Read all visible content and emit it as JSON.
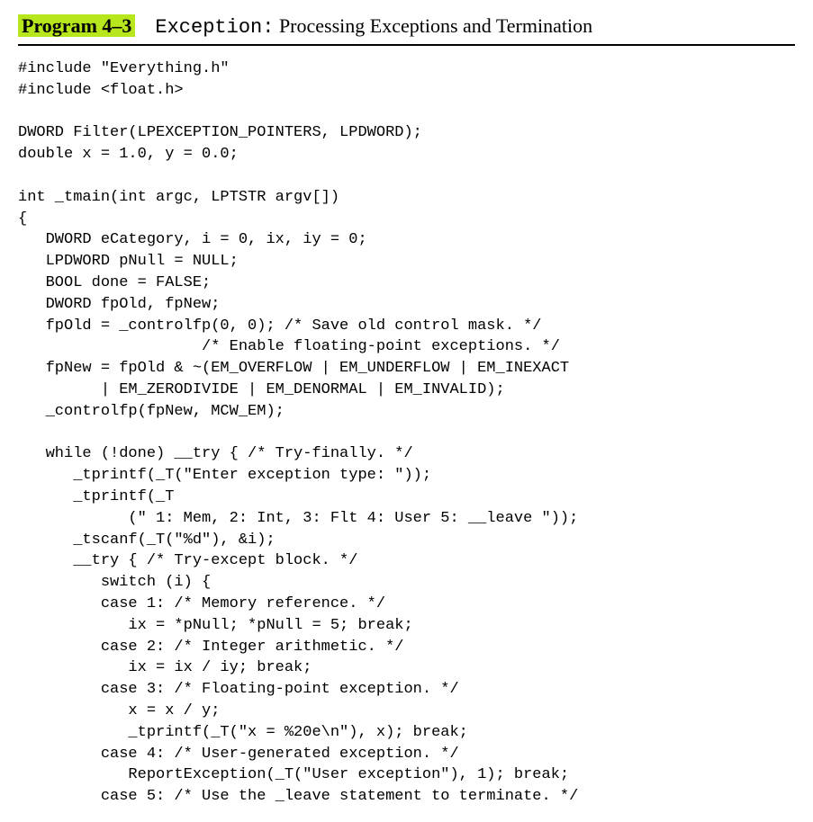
{
  "heading": {
    "program_label": "Program 4–3",
    "code_title": "Exception:",
    "subtitle": "Processing Exceptions and Termination"
  },
  "code": "#include \"Everything.h\"\n#include <float.h>\n\nDWORD Filter(LPEXCEPTION_POINTERS, LPDWORD);\ndouble x = 1.0, y = 0.0;\n\nint _tmain(int argc, LPTSTR argv[])\n{\n   DWORD eCategory, i = 0, ix, iy = 0;\n   LPDWORD pNull = NULL;\n   BOOL done = FALSE;\n   DWORD fpOld, fpNew;\n   fpOld = _controlfp(0, 0); /* Save old control mask. */\n                    /* Enable floating-point exceptions. */\n   fpNew = fpOld & ~(EM_OVERFLOW | EM_UNDERFLOW | EM_INEXACT\n         | EM_ZERODIVIDE | EM_DENORMAL | EM_INVALID);\n   _controlfp(fpNew, MCW_EM);\n\n   while (!done) __try { /* Try-finally. */\n      _tprintf(_T(\"Enter exception type: \"));\n      _tprintf(_T\n            (\" 1: Mem, 2: Int, 3: Flt 4: User 5: __leave \"));\n      _tscanf(_T(\"%d\"), &i);\n      __try { /* Try-except block. */\n         switch (i) {\n         case 1: /* Memory reference. */\n            ix = *pNull; *pNull = 5; break;\n         case 2: /* Integer arithmetic. */\n            ix = ix / iy; break;\n         case 3: /* Floating-point exception. */\n            x = x / y;\n            _tprintf(_T(\"x = %20e\\n\"), x); break;\n         case 4: /* User-generated exception. */\n            ReportException(_T(\"User exception\"), 1); break;\n         case 5: /* Use the _leave statement to terminate. */"
}
